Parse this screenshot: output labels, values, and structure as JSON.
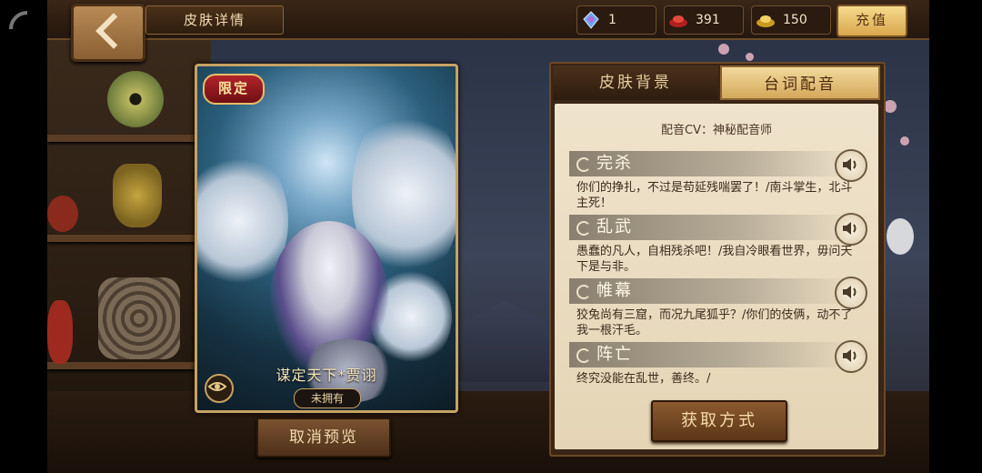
{
  "header": {
    "back_icon": "chevron-left-icon",
    "title": "皮肤详情"
  },
  "resources": [
    {
      "icon": "crystal-icon",
      "value": "1"
    },
    {
      "icon": "ruby-ingot-icon",
      "value": "391"
    },
    {
      "icon": "gold-ingot-icon",
      "value": "150"
    }
  ],
  "recharge_label": "充值",
  "card": {
    "badge": "限定",
    "name": "谋定天下*贾诩",
    "status": "未拥有",
    "preview_icon": "eye-icon"
  },
  "cancel_preview_label": "取消预览",
  "panel": {
    "tabs": [
      {
        "label": "皮肤背景",
        "active": false
      },
      {
        "label": "台词配音",
        "active": true
      }
    ],
    "cv": "配音CV：神秘配音师",
    "lines": [
      {
        "name": "完杀",
        "text": "你们的挣扎，不过是苟延残喘罢了！/南斗掌生，北斗主死！"
      },
      {
        "name": "乱武",
        "text": "愚蠢的凡人，自相残杀吧！/我自冷眼看世界，毋问天下是与非。"
      },
      {
        "name": "帷幕",
        "text": "狡兔尚有三窟，而况九尾狐乎？/你们的伎俩，动不了我一根汗毛。"
      },
      {
        "name": "阵亡",
        "text": "终究没能在乱世，善终。/"
      }
    ],
    "obtain_label": "获取方式"
  }
}
